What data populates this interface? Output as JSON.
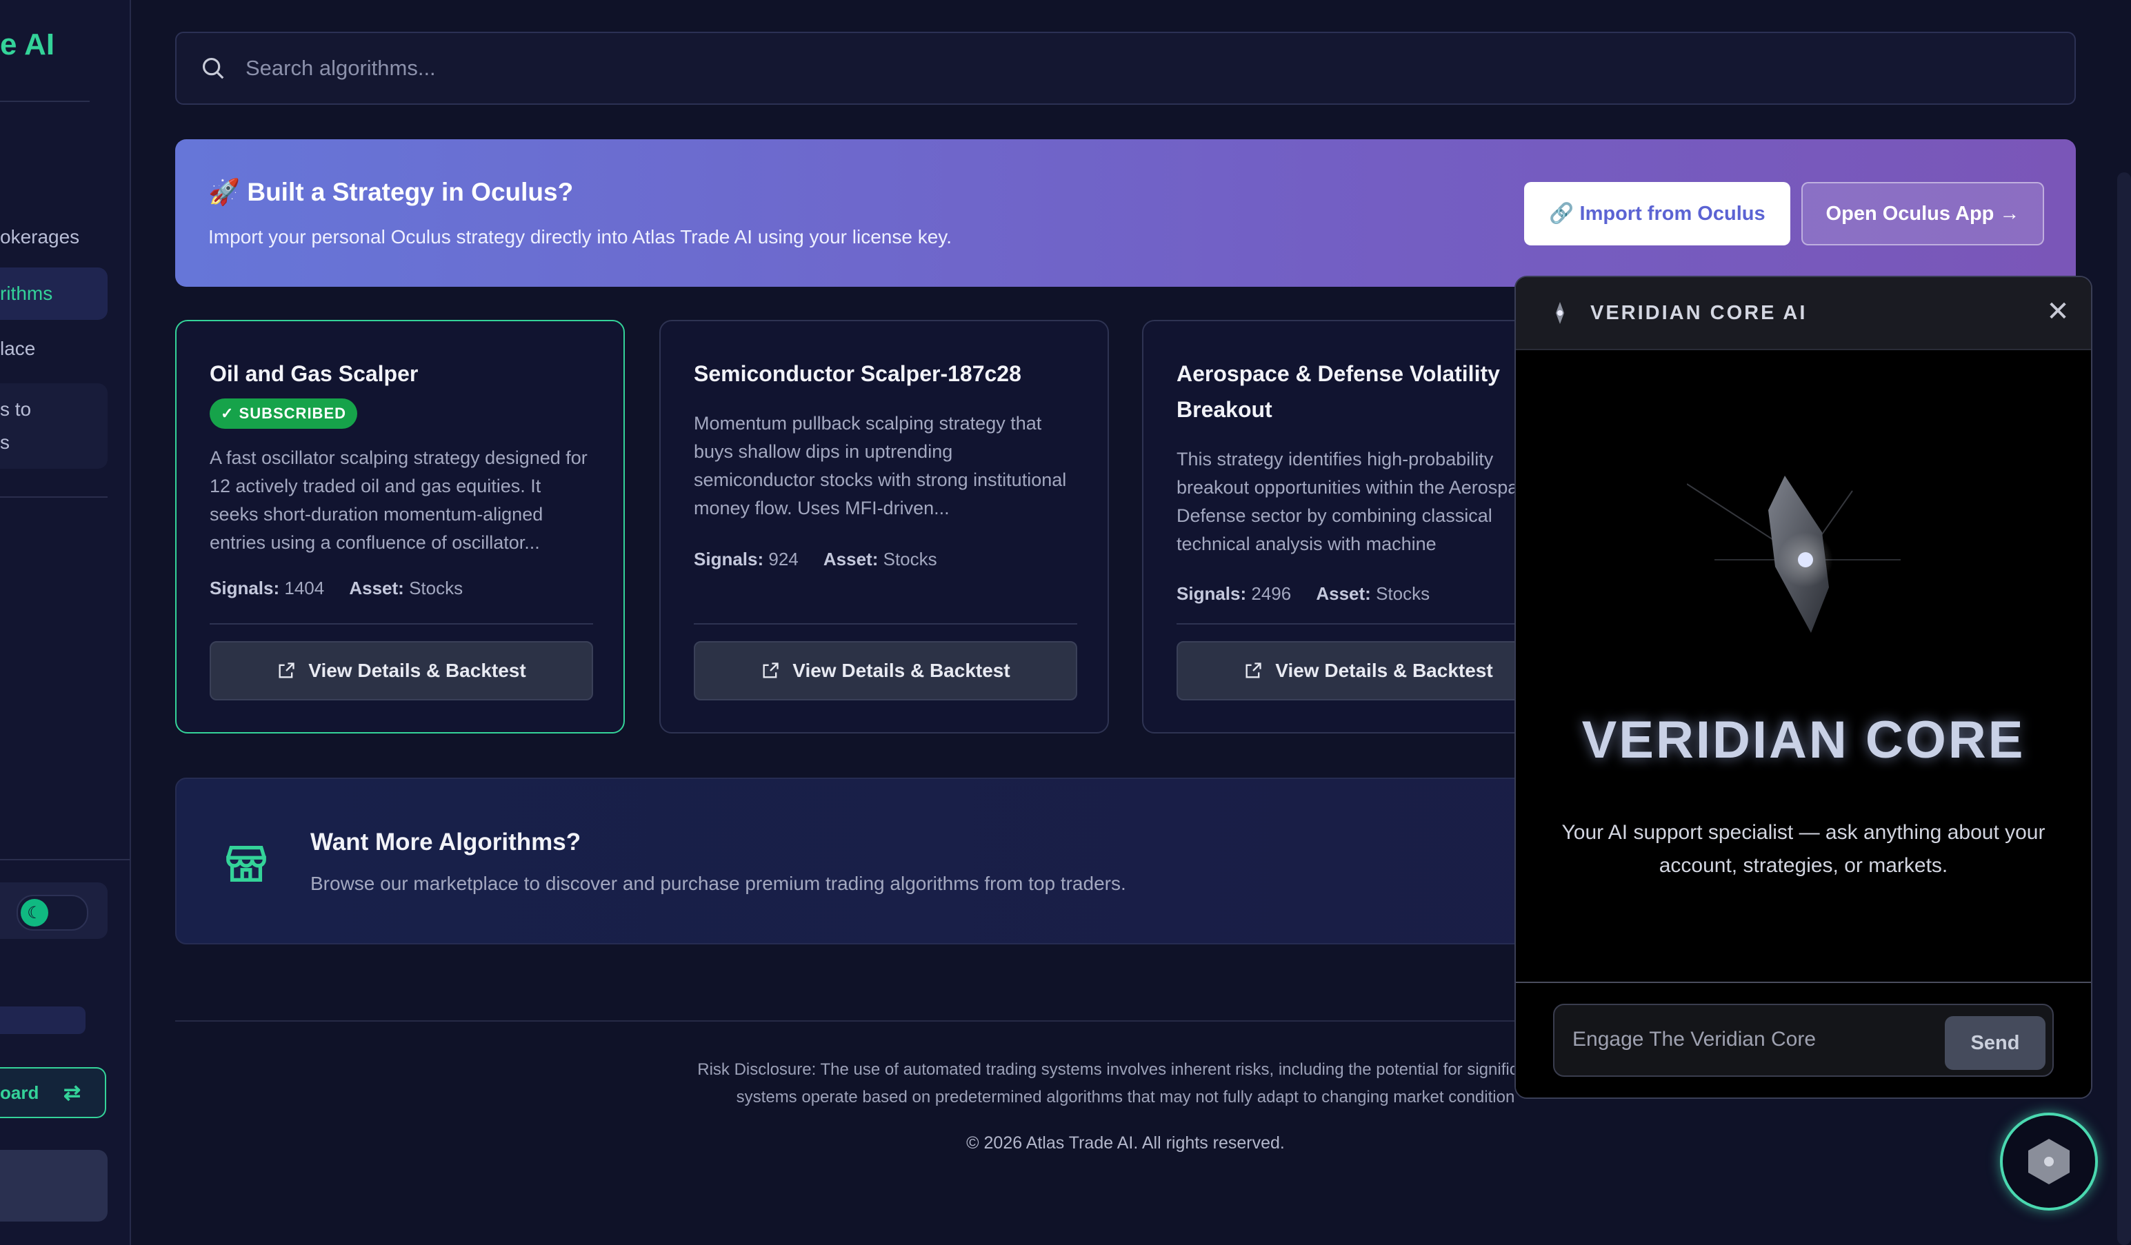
{
  "sidebar": {
    "brand": "e AI",
    "items": [
      {
        "label": "okerages"
      },
      {
        "label": "rithms"
      },
      {
        "label": "lace"
      },
      {
        "label": "s to"
      },
      {
        "label": "s"
      }
    ],
    "dashboard_label": "oard",
    "colors": {
      "accent": "#34d399"
    }
  },
  "search": {
    "placeholder": "Search algorithms..."
  },
  "banner": {
    "title": "🚀 Built a Strategy in Oculus?",
    "subtitle": "Import your personal Oculus strategy directly into Atlas Trade AI using your license key.",
    "import_label": "🔗 Import from Oculus",
    "open_label": "Open Oculus App →"
  },
  "cards": [
    {
      "title": "Oil and Gas Scalper",
      "badge": "✓ SUBSCRIBED",
      "description": "A fast oscillator scalping strategy designed for 12 actively traded oil and gas equities. It seeks short-duration momentum-aligned entries using a confluence of oscillator...",
      "signals_label": "Signals:",
      "signals": "1404",
      "asset_label": "Asset:",
      "asset": "Stocks",
      "button": "View Details & Backtest"
    },
    {
      "title": "Semiconductor Scalper-187c28",
      "description": "Momentum pullback scalping strategy that buys shallow dips in uptrending semiconductor stocks with strong institutional money flow. Uses MFI-driven...",
      "signals_label": "Signals:",
      "signals": "924",
      "asset_label": "Asset:",
      "asset": "Stocks",
      "button": "View Details & Backtest"
    },
    {
      "title": "Aerospace & Defense Volatility Breakout",
      "description": "This strategy identifies high-probability breakout opportunities within the Aerospace & Defense sector by combining classical technical analysis with machine",
      "signals_label": "Signals:",
      "signals": "2496",
      "asset_label": "Asset:",
      "asset": "Stocks",
      "button": "View Details & Backtest"
    }
  ],
  "more": {
    "title": "Want More Algorithms?",
    "subtitle": "Browse our marketplace to discover and purchase premium trading algorithms from top traders."
  },
  "footer": {
    "risk_line1": "Risk Disclosure: The use of automated trading systems involves inherent risks, including the potential for significant fi",
    "risk_line2": "systems operate based on predetermined algorithms that may not fully adapt to changing market condition",
    "copyright": "© 2026 Atlas Trade AI. All rights reserved."
  },
  "chat": {
    "header_title": "VERIDIAN CORE AI",
    "brand": "VERIDIAN CORE",
    "description": "Your AI support specialist — ask anything about your account, strategies, or markets.",
    "input_placeholder": "Engage The Veridian Core",
    "send_label": "Send"
  }
}
